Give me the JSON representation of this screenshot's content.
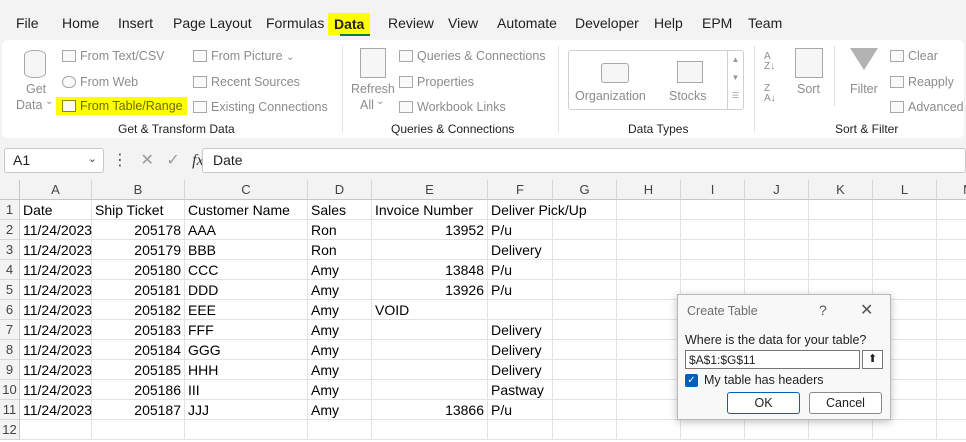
{
  "menu_tabs": [
    "File",
    "Home",
    "Insert",
    "Page Layout",
    "Formulas",
    "Data",
    "Review",
    "View",
    "Automate",
    "Developer",
    "Help",
    "EPM",
    "Team"
  ],
  "ribbon": {
    "get_data": {
      "line1": "Get",
      "line2": "Data",
      "caret": "⌄"
    },
    "get_transform": {
      "from_text_csv": "From Text/CSV",
      "from_web": "From Web",
      "from_table_range": "From Table/Range",
      "from_picture": "From Picture",
      "picture_caret": "⌄",
      "recent_sources": "Recent Sources",
      "existing_connections": "Existing Connections",
      "group_label": "Get & Transform Data"
    },
    "queries": {
      "refresh_line1": "Refresh",
      "refresh_line2": "All",
      "refresh_caret": "⌄",
      "queries_connections": "Queries & Connections",
      "properties": "Properties",
      "workbook_links": "Workbook Links",
      "group_label": "Queries & Connections"
    },
    "data_types": {
      "organization": "Organization",
      "stocks": "Stocks",
      "group_label": "Data Types"
    },
    "sort_filter": {
      "sort": "Sort",
      "filter": "Filter",
      "clear": "Clear",
      "reapply": "Reapply",
      "advanced": "Advanced",
      "group_label": "Sort & Filter"
    }
  },
  "formula_bar": {
    "name_box": "A1",
    "name_caret": "⌄",
    "more": "⋮",
    "cancel": "✕",
    "enter": "✓",
    "fx": "fx",
    "content": "Date"
  },
  "columns": [
    "A",
    "B",
    "C",
    "D",
    "E",
    "F",
    "G",
    "H",
    "I",
    "J",
    "K",
    "L",
    "M"
  ],
  "rows": [
    "1",
    "2",
    "3",
    "4",
    "5",
    "6",
    "7",
    "8",
    "9",
    "10",
    "11",
    "12"
  ],
  "table": [
    [
      "Date",
      "Ship Ticket",
      "Customer Name",
      "Sales",
      "Invoice Number",
      "Deliver Pick/Up"
    ],
    [
      "11/24/2023",
      "205178",
      "AAA",
      "Ron",
      "13952",
      "P/u"
    ],
    [
      "11/24/2023",
      "205179",
      "BBB",
      "Ron",
      "",
      "Delivery"
    ],
    [
      "11/24/2023",
      "205180",
      "CCC",
      "Amy",
      "13848",
      "P/u"
    ],
    [
      "11/24/2023",
      "205181",
      "DDD",
      "Amy",
      "13926",
      "P/u"
    ],
    [
      "11/24/2023",
      "205182",
      "EEE",
      "Amy",
      "VOID",
      ""
    ],
    [
      "11/24/2023",
      "205183",
      "FFF",
      "Amy",
      "",
      "Delivery"
    ],
    [
      "11/24/2023",
      "205184",
      "GGG",
      "Amy",
      "",
      "Delivery"
    ],
    [
      "11/24/2023",
      "205185",
      "HHH",
      "Amy",
      "",
      "Delivery"
    ],
    [
      "11/24/2023",
      "205186",
      "III",
      "Amy",
      "",
      "Pastway"
    ],
    [
      "11/24/2023",
      "205187",
      "JJJ",
      "Amy",
      "13866",
      "P/u"
    ]
  ],
  "dialog": {
    "title": "Create Table",
    "help": "?",
    "close": "✕",
    "question": "Where is the data for your table?",
    "range": "$A$1:$G$11",
    "ref_icon": "⬆",
    "checkbox_label": "My table has headers",
    "checkbox_checked": true,
    "ok": "OK",
    "cancel": "Cancel"
  },
  "colors": {
    "highlight": "#ffff00",
    "accent": "#107c41",
    "checkbox": "#005fb8"
  }
}
